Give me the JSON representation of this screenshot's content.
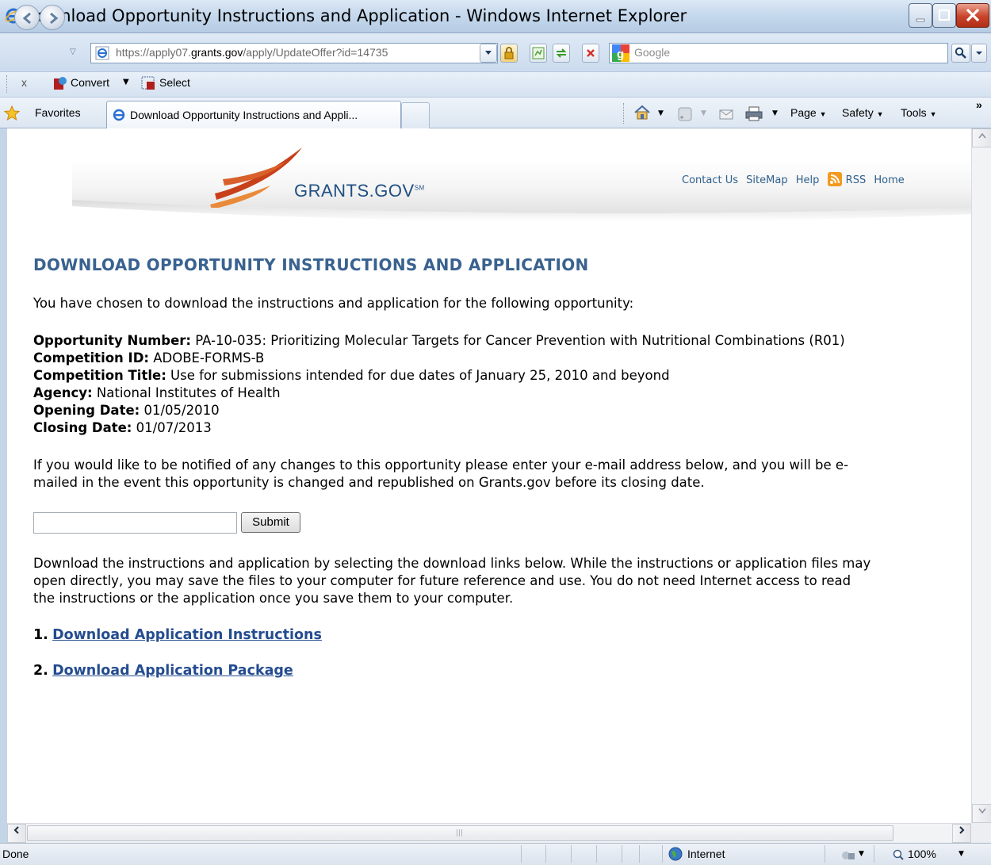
{
  "window": {
    "title": "Download Opportunity Instructions and Application - Windows Internet Explorer"
  },
  "address_bar": {
    "url_scheme": "https://",
    "url_host": "apply07.grants.gov",
    "url_path": "/apply/UpdateOffer?id=14735",
    "url_host_prefix": "apply07.",
    "url_host_main": "grants.gov",
    "search_placeholder": "Google"
  },
  "command_bar": {
    "close_label": "x",
    "convert_label": "Convert",
    "select_label": "Select"
  },
  "favorites_bar": {
    "favorites_label": "Favorites",
    "tab_label": "Download Opportunity Instructions and Appli...",
    "page_label": "Page",
    "safety_label": "Safety",
    "tools_label": "Tools",
    "overflow_label": "»"
  },
  "site": {
    "logo_text": "GRANTS.GOV",
    "logo_mark": "SM",
    "nav": [
      "Contact Us",
      "SiteMap",
      "Help",
      "RSS",
      "Home"
    ]
  },
  "content": {
    "heading": "DOWNLOAD OPPORTUNITY INSTRUCTIONS AND APPLICATION",
    "intro": "You have chosen to download the instructions and application for the following opportunity:",
    "fields": [
      {
        "label": "Opportunity Number:",
        "value": "PA-10-035: Prioritizing Molecular Targets for Cancer Prevention with Nutritional Combinations (R01)"
      },
      {
        "label": "Competition ID:",
        "value": "ADOBE-FORMS-B"
      },
      {
        "label": "Competition Title:",
        "value": "Use for submissions intended for due dates of January 25, 2010 and beyond"
      },
      {
        "label": "Agency:",
        "value": "National Institutes of Health"
      },
      {
        "label": "Opening Date:",
        "value": "01/05/2010"
      },
      {
        "label": "Closing Date:",
        "value": "01/07/2013"
      }
    ],
    "notify_text_line1": "If you would like to be notified of any changes to this opportunity please enter your e-mail address below, and you will be e-",
    "notify_text_line2": "mailed in the event this opportunity is changed and republished on Grants.gov before its closing date.",
    "email_value": "",
    "submit_label": "Submit",
    "download_text_line1": "Download the instructions and application by selecting the download links below. While the instructions or application files may",
    "download_text_line2": "open directly, you may save the files to your computer for future reference and use. You do not need Internet access to read",
    "download_text_line3": "the instructions or the application once you save them to your computer.",
    "links": [
      {
        "number": "1.",
        "label": "Download Application Instructions"
      },
      {
        "number": "2.",
        "label": "Download Application Package"
      }
    ]
  },
  "status_bar": {
    "status": "Done",
    "zone": "Internet",
    "zoom": "100%"
  }
}
